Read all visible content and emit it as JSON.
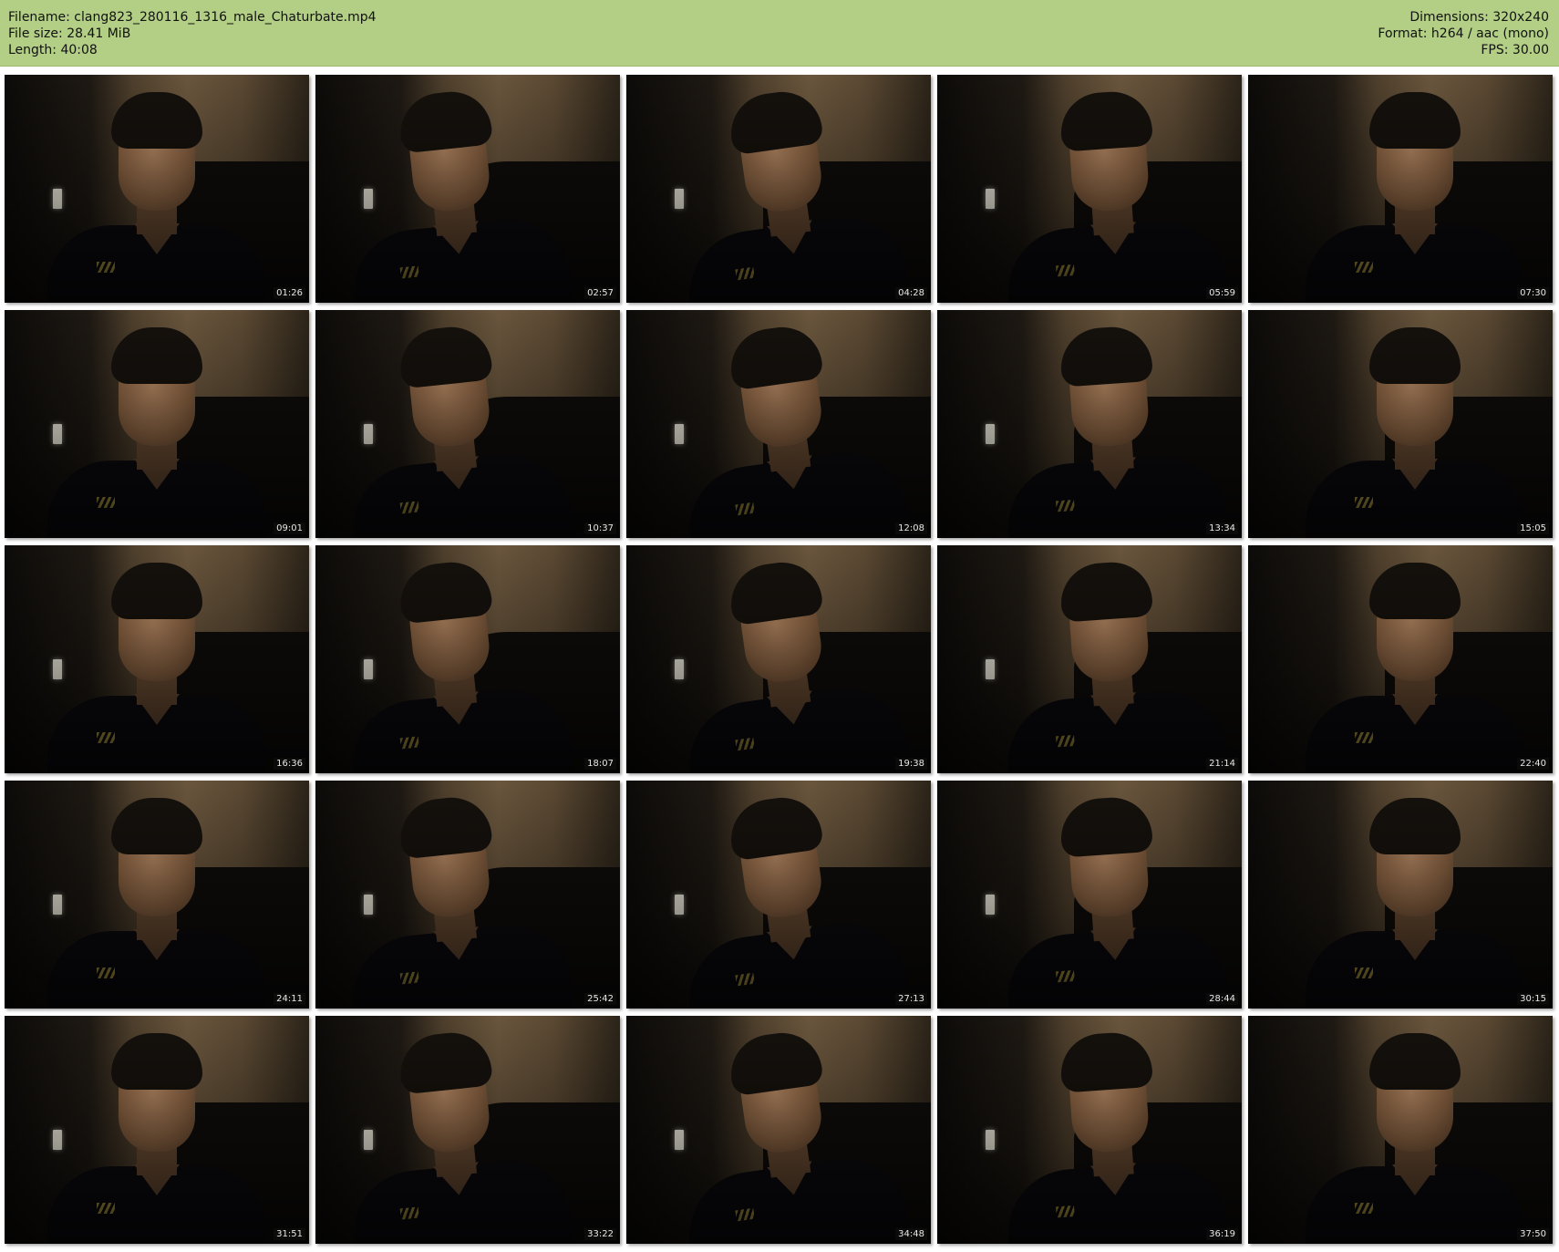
{
  "header": {
    "filename": "Filename: clang823_280116_1316_male_Chaturbate.mp4",
    "filesize": "File size: 28.41 MiB",
    "length": "Length: 40:08",
    "dimensions": "Dimensions: 320x240",
    "format": "Format: h264 / aac (mono)",
    "fps": "FPS: 30.00"
  },
  "colors": {
    "header_bg": "#b3cf85",
    "page_bg": "#ffffff",
    "timestamp_text": "#e8e8e8"
  },
  "thumbnails": [
    {
      "time": "01:26"
    },
    {
      "time": "02:57"
    },
    {
      "time": "04:28"
    },
    {
      "time": "05:59"
    },
    {
      "time": "07:30"
    },
    {
      "time": "09:01"
    },
    {
      "time": "10:37"
    },
    {
      "time": "12:08"
    },
    {
      "time": "13:34"
    },
    {
      "time": "15:05"
    },
    {
      "time": "16:36"
    },
    {
      "time": "18:07"
    },
    {
      "time": "19:38"
    },
    {
      "time": "21:14"
    },
    {
      "time": "22:40"
    },
    {
      "time": "24:11"
    },
    {
      "time": "25:42"
    },
    {
      "time": "27:13"
    },
    {
      "time": "28:44"
    },
    {
      "time": "30:15"
    },
    {
      "time": "31:51"
    },
    {
      "time": "33:22"
    },
    {
      "time": "34:48"
    },
    {
      "time": "36:19"
    },
    {
      "time": "37:50"
    }
  ]
}
